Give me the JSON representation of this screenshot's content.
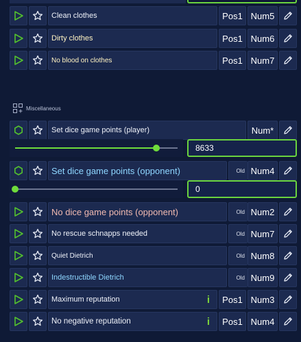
{
  "section": {
    "label": "Miscellaneous",
    "icon": "grid-plus-icon"
  },
  "rows": [
    {
      "name": "Clean clothes",
      "pos": "Pos1",
      "num": "Num5"
    },
    {
      "name": "Dirty clothes",
      "pos": "Pos1",
      "num": "Num6"
    },
    {
      "name": "No blood on clothes",
      "pos": "Pos1",
      "num": "Num7"
    },
    {
      "name": "Set dice game points (player)",
      "num": "Num*"
    },
    {
      "name": "Set dice game points (opponent)",
      "old": "Old",
      "num": "Num4"
    },
    {
      "name": "No dice game points (opponent)",
      "old": "Old",
      "num": "Num2"
    },
    {
      "name": "No rescue schnapps needed",
      "old": "Old",
      "num": "Num7"
    },
    {
      "name": "Quiet Dietrich",
      "old": "Old",
      "num": "Num8"
    },
    {
      "name": "Indestructible Dietrich",
      "old": "Old",
      "num": "Num9"
    },
    {
      "name": "Maximum reputation",
      "indicator": "i",
      "pos": "Pos1",
      "num": "Num3"
    },
    {
      "name": "No negative reputation",
      "indicator": "i",
      "pos": "Pos1",
      "num": "Num4"
    }
  ],
  "sliders": [
    {
      "value": "8633",
      "level": 0.87
    },
    {
      "value": "0",
      "level": 0.0
    }
  ],
  "colors": {
    "accent_green": "#6fdc3b",
    "name_light_blue": "#8ed6ff",
    "name_pink": "#f0b9b0",
    "name_yellow": "#fff3c2"
  }
}
